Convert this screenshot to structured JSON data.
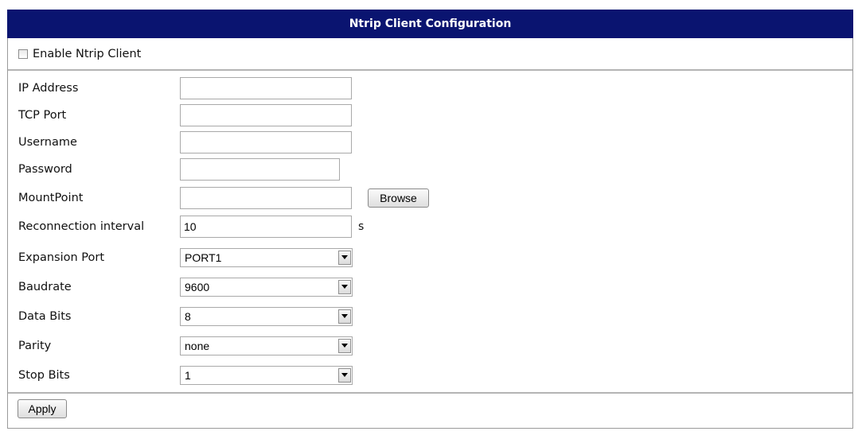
{
  "header": {
    "title": "Ntrip Client Configuration"
  },
  "enable": {
    "label": "Enable Ntrip Client",
    "checked": false
  },
  "fields": {
    "ip_address": {
      "label": "IP Address",
      "value": ""
    },
    "tcp_port": {
      "label": "TCP Port",
      "value": ""
    },
    "username": {
      "label": "Username",
      "value": ""
    },
    "password": {
      "label": "Password",
      "value": ""
    },
    "mountpoint": {
      "label": "MountPoint",
      "value": "",
      "browse_label": "Browse"
    },
    "reconnection_interval": {
      "label": "Reconnection interval",
      "value": "10",
      "unit": "s"
    },
    "expansion_port": {
      "label": "Expansion Port",
      "value": "PORT1"
    },
    "baudrate": {
      "label": "Baudrate",
      "value": "9600"
    },
    "data_bits": {
      "label": "Data Bits",
      "value": "8"
    },
    "parity": {
      "label": "Parity",
      "value": "none"
    },
    "stop_bits": {
      "label": "Stop Bits",
      "value": "1"
    }
  },
  "actions": {
    "apply_label": "Apply"
  },
  "colors": {
    "header_bg": "#0a1470",
    "header_text": "#ffffff",
    "separator": "#b4b4b4"
  }
}
